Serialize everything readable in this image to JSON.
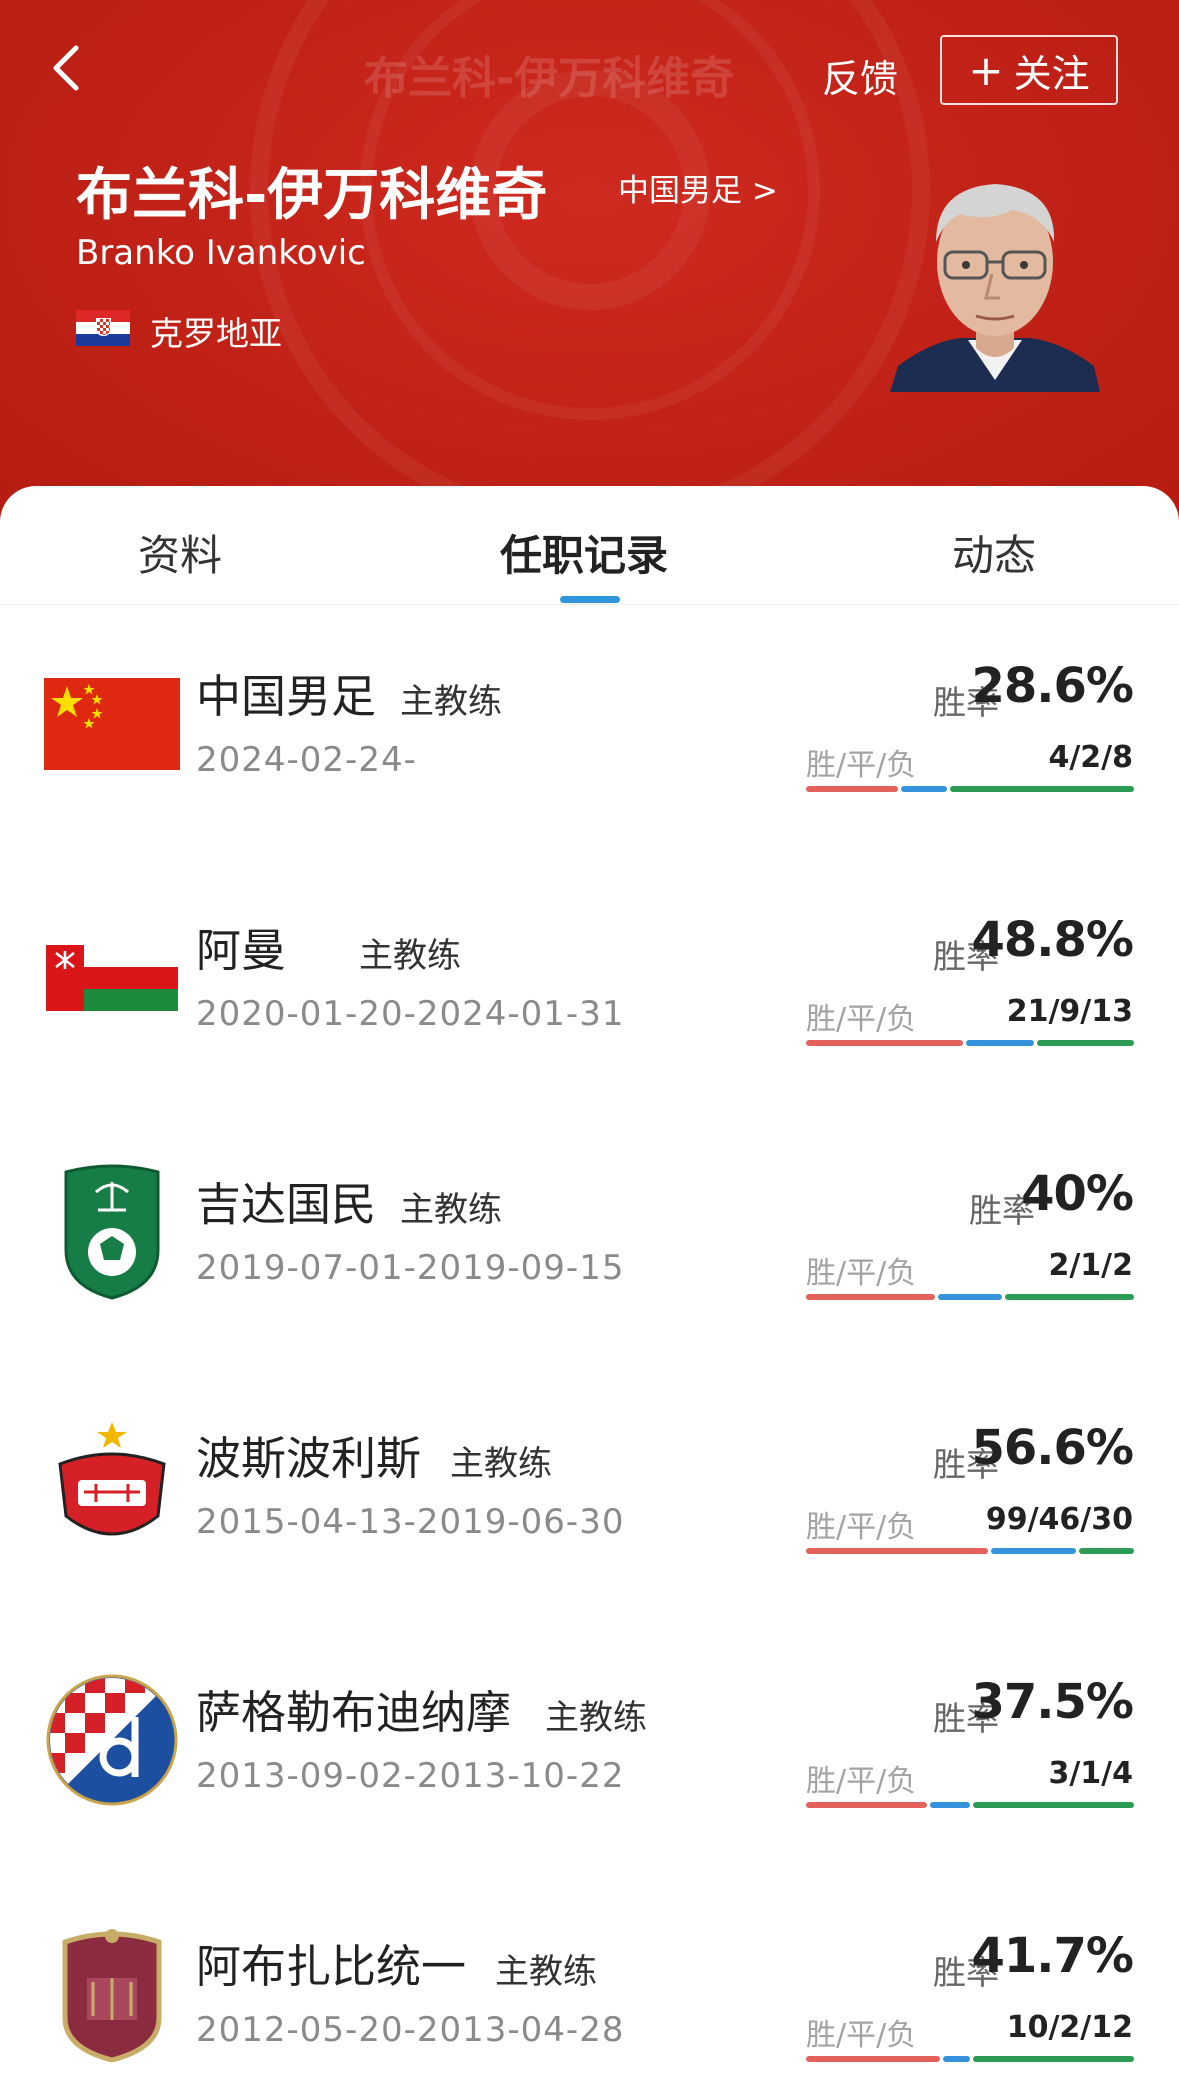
{
  "header": {
    "faded_title": "布兰科-伊万科维奇",
    "feedback_label": "反馈",
    "follow_label": "关注",
    "follow_plus": "+",
    "name_cn": "布兰科-伊万科维奇",
    "team_link": "中国男足 >",
    "name_en": "Branko Ivankovic",
    "nationality": "克罗地亚"
  },
  "tabs": [
    {
      "label": "资料"
    },
    {
      "label": "任职记录"
    },
    {
      "label": "动态"
    }
  ],
  "records": [
    {
      "team": "中国男足",
      "role": "主教练",
      "dates": "2024-02-24-",
      "rate_label": "胜率",
      "rate": "28.6%",
      "wdl_label": "胜/平/负",
      "wdl": "4/2/8",
      "wins": 4,
      "draws": 2,
      "losses": 8,
      "logo_icon": "china-flag-icon"
    },
    {
      "team": "阿曼",
      "role": "主教练",
      "dates": "2020-01-20-2024-01-31",
      "rate_label": "胜率",
      "rate": "48.8%",
      "wdl_label": "胜/平/负",
      "wdl": "21/9/13",
      "wins": 21,
      "draws": 9,
      "losses": 13,
      "logo_icon": "oman-flag-icon"
    },
    {
      "team": "吉达国民",
      "role": "主教练",
      "dates": "2019-07-01-2019-09-15",
      "rate_label": "胜率",
      "rate": "40%",
      "wdl_label": "胜/平/负",
      "wdl": "2/1/2",
      "wins": 2,
      "draws": 1,
      "losses": 2,
      "logo_icon": "al-ahli-crest-icon"
    },
    {
      "team": "波斯波利斯",
      "role": "主教练",
      "dates": "2015-04-13-2019-06-30",
      "rate_label": "胜率",
      "rate": "56.6%",
      "wdl_label": "胜/平/负",
      "wdl": "99/46/30",
      "wins": 99,
      "draws": 46,
      "losses": 30,
      "logo_icon": "persepolis-crest-icon"
    },
    {
      "team": "萨格勒布迪纳摩",
      "role": "主教练",
      "dates": "2013-09-02-2013-10-22",
      "rate_label": "胜率",
      "rate": "37.5%",
      "wdl_label": "胜/平/负",
      "wdl": "3/1/4",
      "wins": 3,
      "draws": 1,
      "losses": 4,
      "logo_icon": "dinamo-zagreb-crest-icon"
    },
    {
      "team": "阿布扎比统一",
      "role": "主教练",
      "dates": "2012-05-20-2013-04-28",
      "rate_label": "胜率",
      "rate": "41.7%",
      "wdl_label": "胜/平/负",
      "wdl": "10/2/12",
      "wins": 10,
      "draws": 2,
      "losses": 12,
      "logo_icon": "al-wahda-crest-icon"
    }
  ],
  "colors": {
    "header_red": "#c32318",
    "win": "#e4615c",
    "draw": "#3592dd",
    "loss": "#2d9b53",
    "tab_indicator": "#2f95dd"
  }
}
